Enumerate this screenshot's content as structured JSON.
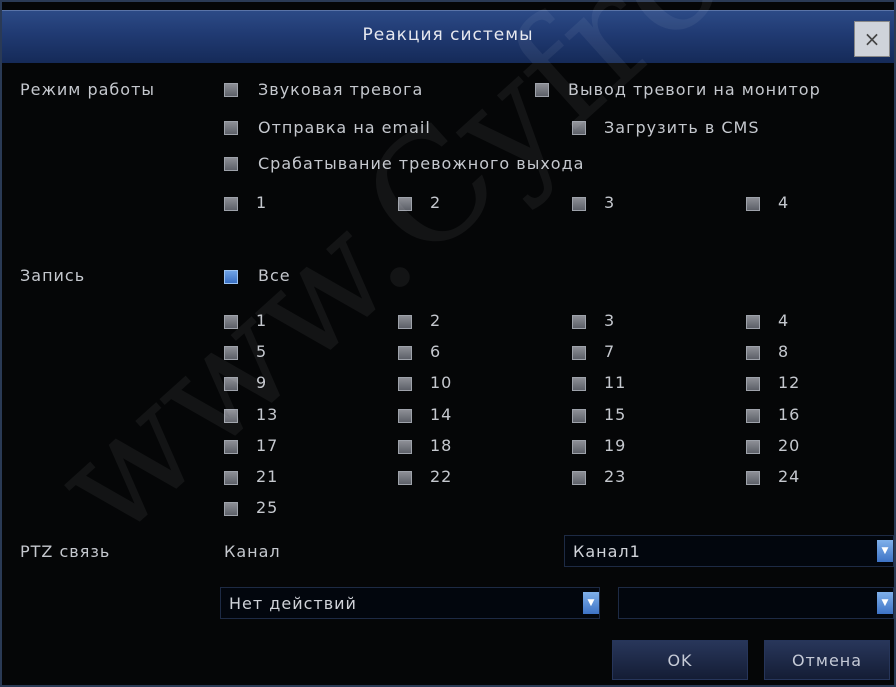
{
  "dialog": {
    "title": "Реакция системы",
    "close_label": "×"
  },
  "mode": {
    "label": "Режим работы",
    "options": [
      {
        "label": "Звуковая тревога",
        "checked": false
      },
      {
        "label": "Вывод тревоги на монитор",
        "checked": false
      },
      {
        "label": "Отправка на email",
        "checked": false
      },
      {
        "label": "Загрузить в CMS",
        "checked": false
      },
      {
        "label": "Срабатывание тревожного выхода",
        "checked": false
      }
    ],
    "alarm_outputs": [
      "1",
      "2",
      "3",
      "4"
    ]
  },
  "record": {
    "label": "Запись",
    "all_label": "Все",
    "all_checked": true,
    "channels": [
      "1",
      "2",
      "3",
      "4",
      "5",
      "6",
      "7",
      "8",
      "9",
      "10",
      "11",
      "12",
      "13",
      "14",
      "15",
      "16",
      "17",
      "18",
      "19",
      "20",
      "21",
      "22",
      "23",
      "24",
      "25"
    ]
  },
  "ptz": {
    "label": "PTZ связь",
    "channel_label": "Канал",
    "channel_value": "Канал1",
    "action_value": "Нет действий",
    "preset_value": ""
  },
  "buttons": {
    "ok": "OK",
    "cancel": "Отмена"
  },
  "watermark": "www.Cyfron.ru",
  "colors": {
    "title_bar": "#203a72",
    "checkbox_checked": "#3a6fc2",
    "background": "#050607"
  }
}
